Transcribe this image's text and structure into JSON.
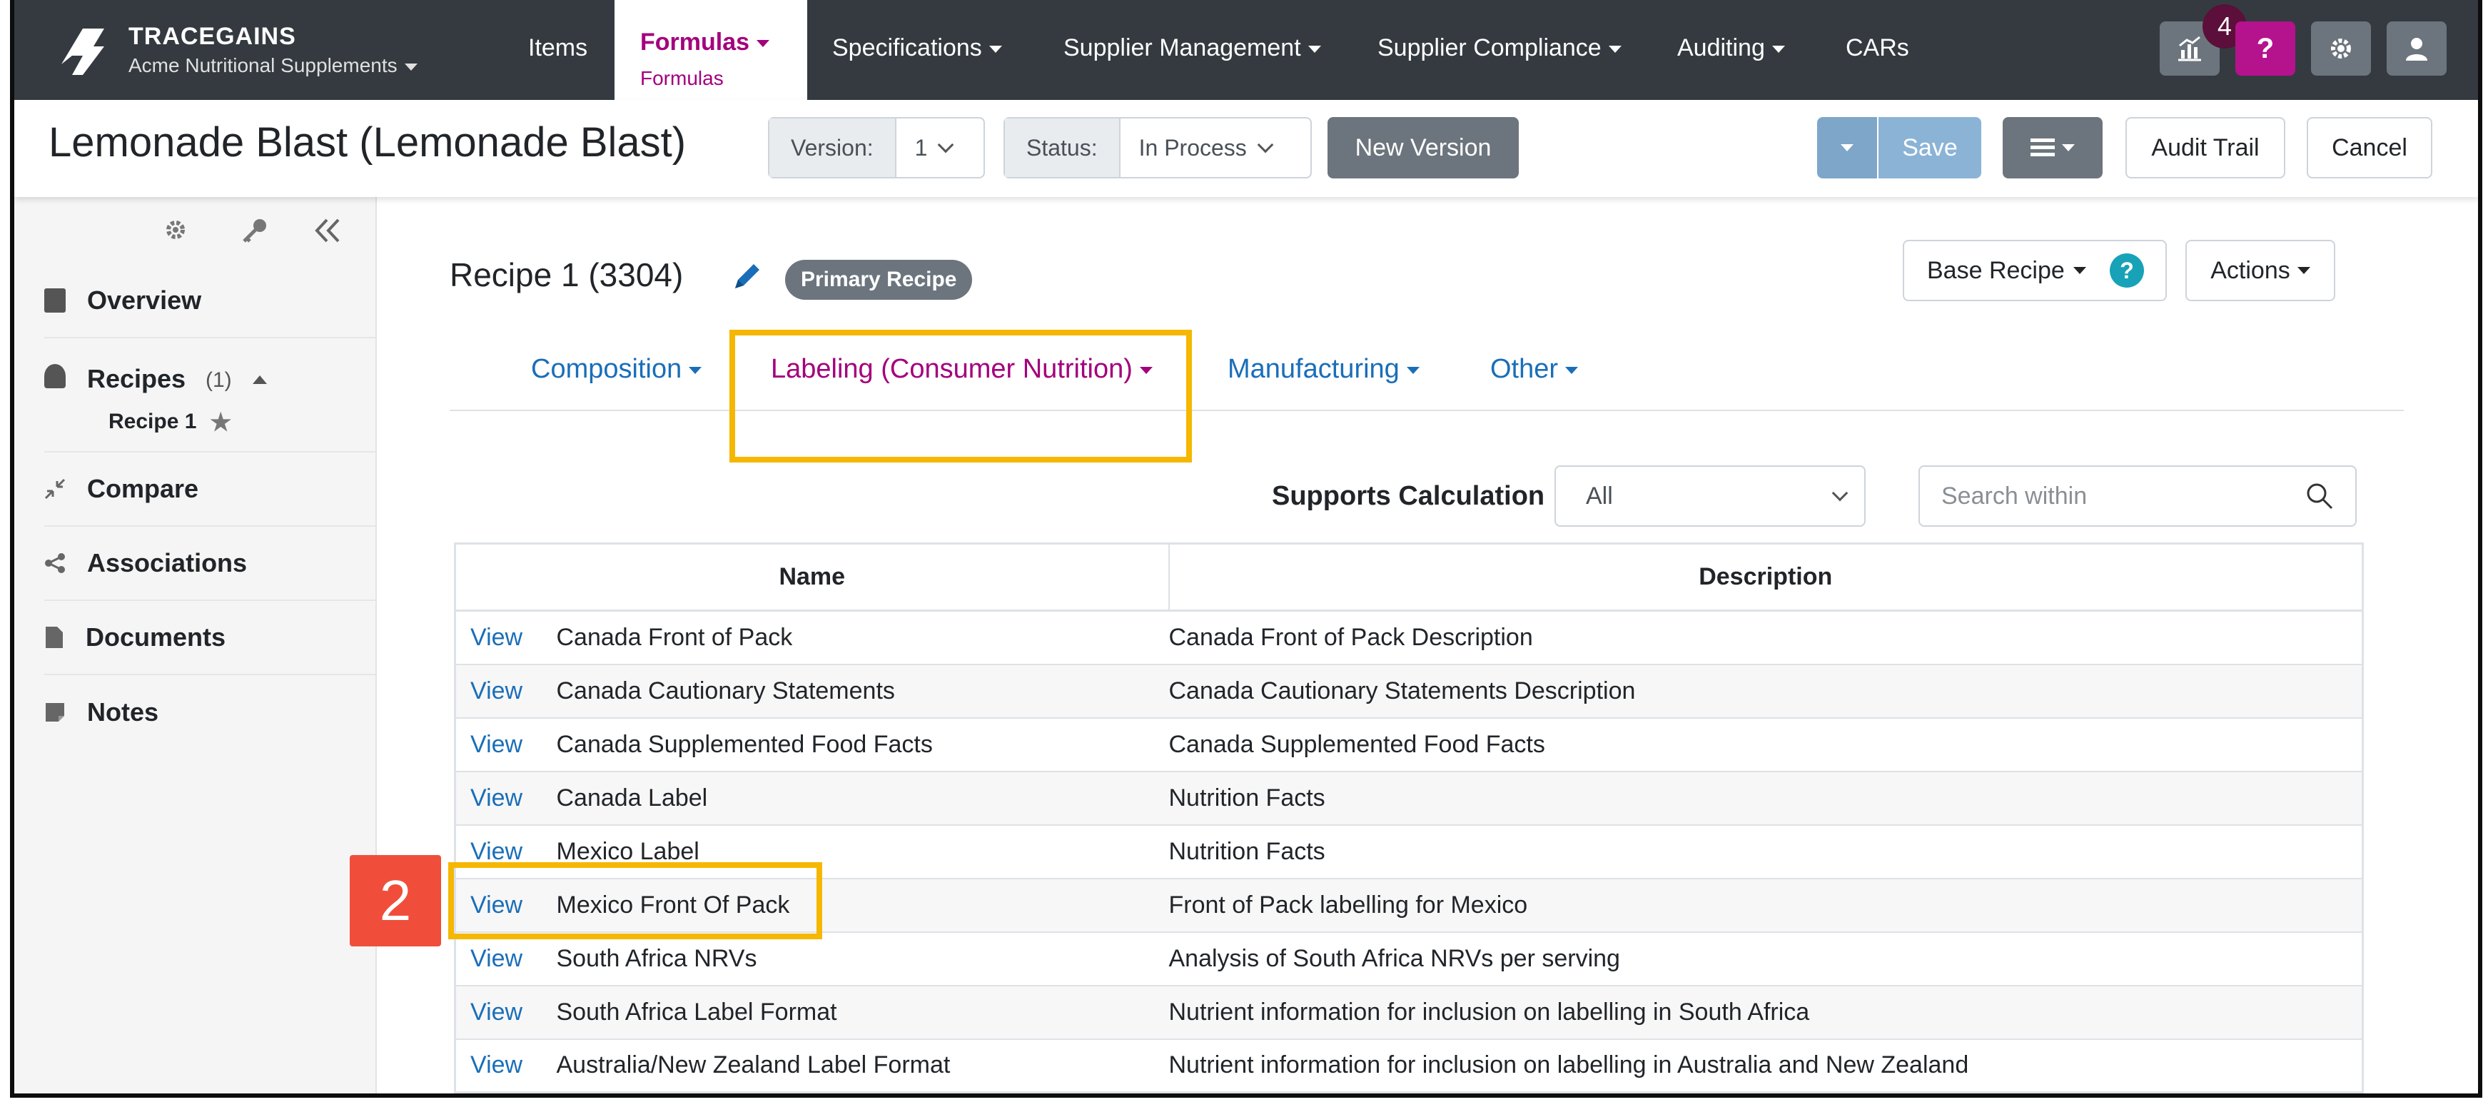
{
  "nav": {
    "brand": "TRACEGAINS",
    "org": "Acme Nutritional Supplements",
    "items": [
      "Items",
      "Specifications",
      "Supplier Management",
      "Supplier Compliance",
      "Auditing",
      "CARs"
    ],
    "active_label": "Formulas",
    "active_sublabel": "Formulas",
    "notif_count": "4",
    "help_label": "?"
  },
  "header": {
    "title": "Lemonade Blast (Lemonade Blast)",
    "version_label": "Version:",
    "version_value": "1",
    "status_label": "Status:",
    "status_value": "In Process",
    "new_version": "New Version",
    "save": "Save",
    "audit_trail": "Audit Trail",
    "cancel": "Cancel"
  },
  "sidebar": {
    "items": [
      {
        "label": "Overview",
        "icon": "clipboard-icon"
      },
      {
        "label": "Recipes",
        "count": "(1)",
        "icon": "recipe-icon",
        "sub": "Recipe 1"
      },
      {
        "label": "Compare",
        "icon": "compress-icon"
      },
      {
        "label": "Associations",
        "icon": "share-icon"
      },
      {
        "label": "Documents",
        "icon": "file-icon"
      },
      {
        "label": "Notes",
        "icon": "note-icon"
      }
    ]
  },
  "main": {
    "recipe_title": "Recipe 1 (3304)",
    "primary_badge": "Primary Recipe",
    "base_recipe": "Base Recipe",
    "actions": "Actions",
    "tabs": [
      "Composition",
      "Labeling (Consumer Nutrition)",
      "Manufacturing",
      "Other"
    ],
    "filter_label": "Supports Calculation",
    "filter_value": "All",
    "search_placeholder": "Search within",
    "step_number": "2"
  },
  "table": {
    "columns": [
      "Name",
      "Description"
    ],
    "link_label": "View",
    "rows": [
      {
        "name": "Canada Front of Pack",
        "description": "Canada Front of Pack Description"
      },
      {
        "name": "Canada Cautionary Statements",
        "description": "Canada Cautionary Statements Description"
      },
      {
        "name": "Canada Supplemented Food Facts",
        "description": "Canada Supplemented Food Facts"
      },
      {
        "name": "Canada Label",
        "description": "Nutrition Facts"
      },
      {
        "name": "Mexico Label",
        "description": "Nutrition Facts"
      },
      {
        "name": "Mexico Front Of Pack",
        "description": "Front of Pack labelling for Mexico"
      },
      {
        "name": "South Africa NRVs",
        "description": "Analysis of South Africa NRVs per serving"
      },
      {
        "name": "South Africa Label Format",
        "description": "Nutrient information for inclusion on labelling in South Africa"
      },
      {
        "name": "Australia/New Zealand Label Format",
        "description": "Nutrient information for inclusion on labelling in Australia and New Zealand"
      }
    ]
  },
  "colors": {
    "accent": "#a3007d",
    "link": "#1a6eb8",
    "highlight": "#f5b700",
    "step": "#f04e3a",
    "nav": "#343a40"
  }
}
